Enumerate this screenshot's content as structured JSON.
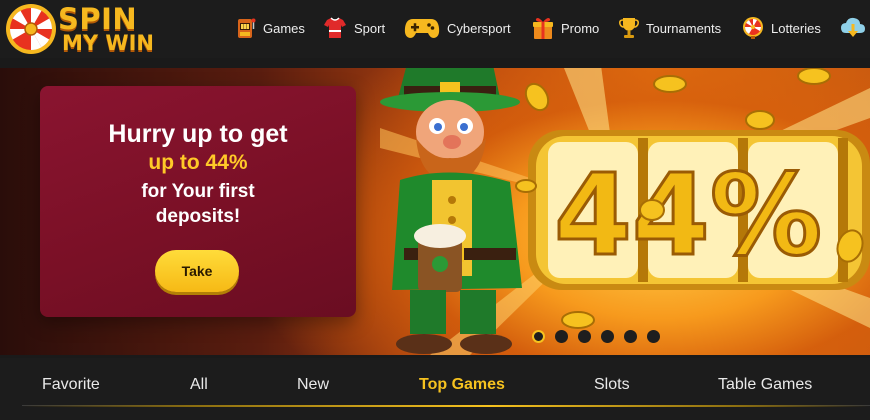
{
  "brand": {
    "line1": "SPIN",
    "line2": "MY WIN",
    "color": "#f6b81f"
  },
  "nav": [
    {
      "label": "Games",
      "icon": "slot-machine-icon"
    },
    {
      "label": "Sport",
      "icon": "jersey-icon"
    },
    {
      "label": "Cybersport",
      "icon": "gamepad-icon"
    },
    {
      "label": "Promo",
      "icon": "gift-icon"
    },
    {
      "label": "Tournaments",
      "icon": "trophy-icon"
    },
    {
      "label": "Lotteries",
      "icon": "lottery-wheel-icon"
    },
    {
      "label": "",
      "icon": "download-cloud-icon"
    }
  ],
  "banner": {
    "line1": "Hurry up to get",
    "line2": "up to 44%",
    "line3": "for Your first",
    "line4": "deposits!",
    "button": "Take",
    "big_text": "44%",
    "slide_count": 6,
    "active_slide": 1
  },
  "tabs": [
    {
      "label": "Favorite",
      "active": false
    },
    {
      "label": "All",
      "active": false
    },
    {
      "label": "New",
      "active": false
    },
    {
      "label": "Top Games",
      "active": true
    },
    {
      "label": "Slots",
      "active": false
    },
    {
      "label": "Table Games",
      "active": false
    }
  ],
  "colors": {
    "accent": "#f6c21f",
    "promo_card": "#7a1026",
    "background": "#1c1c1c"
  }
}
